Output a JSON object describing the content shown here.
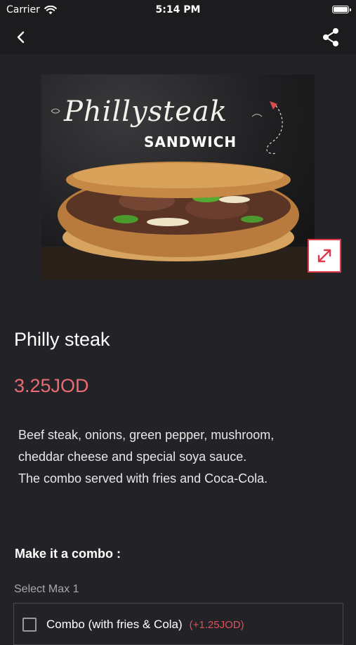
{
  "status_bar": {
    "carrier": "Carrier",
    "time": "5:14 PM"
  },
  "hero_image": {
    "script_text": "Phillysteak",
    "block_text": "SANDWICH"
  },
  "product": {
    "name": "Philly steak",
    "price": "3.25JOD",
    "description": "Beef steak, onions, green pepper, mushroom,\ncheddar cheese and special soya sauce.\nThe combo served with fries and Coca-Cola."
  },
  "combo": {
    "heading": "Make it a combo :",
    "subtitle": "Select Max 1",
    "options": [
      {
        "label": "Combo (with fries & Cola)",
        "price": "(+1.25JOD)",
        "checked": false
      }
    ]
  },
  "colors": {
    "accent": "#ea6b71",
    "background": "#232327",
    "nav": "#1c1c1f"
  }
}
